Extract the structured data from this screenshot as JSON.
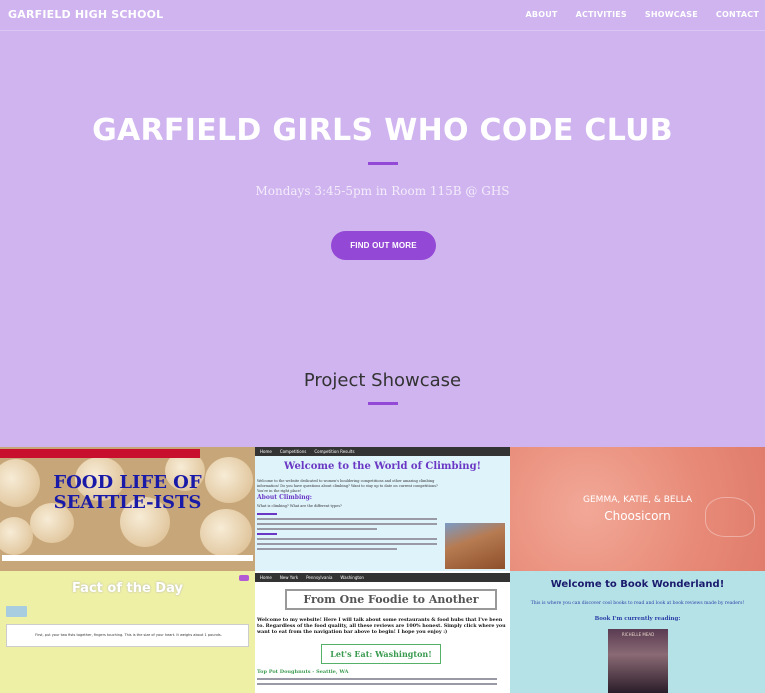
{
  "nav": {
    "brand": "GARFIELD HIGH SCHOOL",
    "links": [
      "ABOUT",
      "ACTIVITIES",
      "SHOWCASE",
      "CONTACT"
    ]
  },
  "hero": {
    "title": "GARFIELD GIRLS WHO CODE CLUB",
    "subtitle": "Mondays 3:45-5pm in Room 115B @ GHS",
    "button": "FIND OUT MORE"
  },
  "showcase": {
    "title": "Project Showcase",
    "projects": {
      "food": {
        "title": "FOOD LIFE OF SEATTLE-ISTS"
      },
      "climbing": {
        "title": "Welcome to the World of Climbing!",
        "nav": [
          "Home",
          "Competitions",
          "Competition Results"
        ],
        "intro": "Welcome to the website dedicated to women's bouldering competitions and other amazing climbing information! Do you have questions about climbing? Want to stay up to date on current competitions? You're in the right place!",
        "heading": "About Climbing:",
        "question": "What is climbing? What are the different types?"
      },
      "choosicorn": {
        "names": "GEMMA, KATIE, & BELLA",
        "title": "Choosicorn"
      },
      "fact": {
        "title": "Fact of the Day",
        "text": "First, put your two fists together, fingers touching. This is the size of your heart. It weighs about 1 pounds."
      },
      "foodie": {
        "title": "From One Foodie to Another",
        "nav": [
          "Home",
          "New York",
          "Pennsylvania",
          "Washington"
        ],
        "intro": "Welcome to my website! Here I will talk about some restaurants & food hubs that I've been to. Regardless of the food quality, all these reviews are 100% honest. Simply click where you want to eat from the navigation bar above to begin! I hope you enjoy :)",
        "section": "Let's Eat: Washington!",
        "subsection": "Top Pot Doughnuts - Seattle, WA"
      },
      "books": {
        "title": "Welcome to Book Wonderland!",
        "text": "This is where you can discover cool books to read and look at book reviews made by readers!",
        "reading": "Book I'm currently reading:",
        "author": "RICHELLE MEAD"
      }
    }
  },
  "colors": {
    "background": "#cfb4ef",
    "accent": "#9448d6"
  }
}
